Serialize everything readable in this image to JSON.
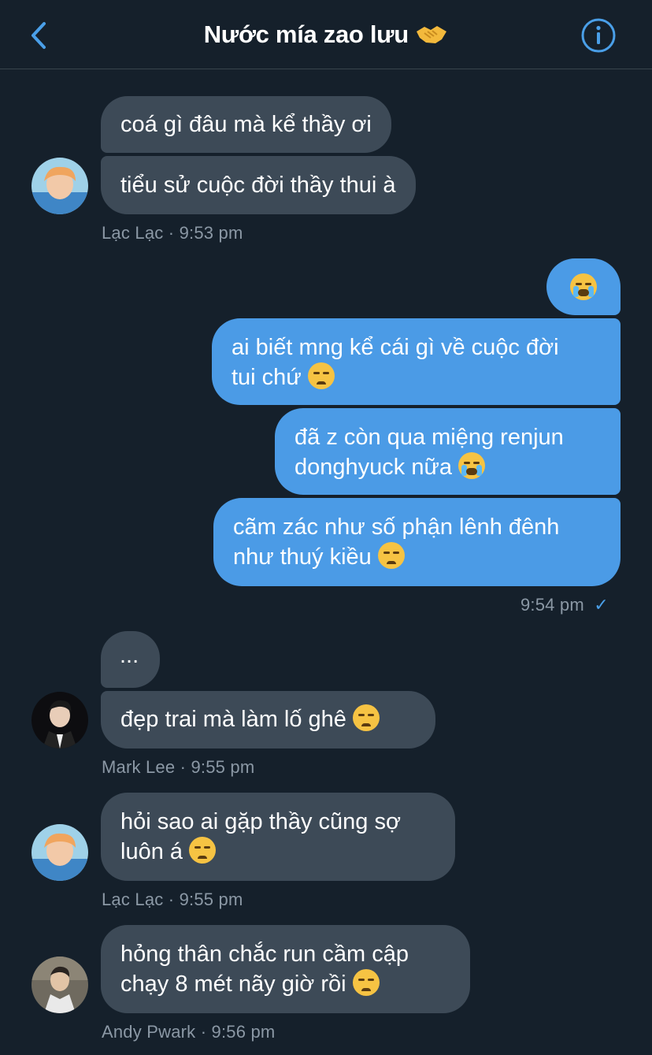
{
  "header": {
    "title": "Nước mía zao lưu",
    "title_emoji": "handshake-emoji"
  },
  "messages": [
    {
      "text": "coá gì đâu mà kể thầy ơi"
    },
    {
      "text": "tiểu sử cuộc đời thầy thui à"
    },
    {
      "meta": "Lạc Lạc · 9:53 pm"
    },
    {
      "emoji": "loudly-crying-face"
    },
    {
      "text": "ai biết mng kể cái gì về cuộc đời",
      "text2": "tui chứ"
    },
    {
      "text": "đã z còn qua miệng renjun",
      "text2": "donghyuck nữa"
    },
    {
      "text": "cãm zác như số phận lênh đênh",
      "text2": "như thuý kiều"
    },
    {
      "meta": "9:54 pm",
      "check": "✓"
    },
    {
      "text": "..."
    },
    {
      "text": "đẹp trai mà làm lố ghê"
    },
    {
      "meta": "Mark Lee · 9:55 pm"
    },
    {
      "text": "hỏi sao ai gặp thầy cũng sợ",
      "text2": "luôn á"
    },
    {
      "meta": "Lạc Lạc · 9:55 pm"
    },
    {
      "text": "hỏng thân chắc run cầm cập",
      "text2": "chạy 8 mét nãy giờ rồi"
    },
    {
      "meta": "Andy Pwark · 9:56 pm"
    }
  ],
  "colors": {
    "background": "#15202b",
    "incoming": "#3d4a57",
    "outgoing": "#4b9be6",
    "accent": "#4a9fe8"
  }
}
